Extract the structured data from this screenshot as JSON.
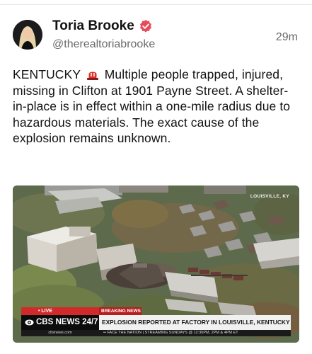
{
  "post": {
    "author_name": "Toria Brooke",
    "handle": "@therealtoriabrooke",
    "timestamp": "29m",
    "text_before_emoji": "KENTUCKY",
    "emoji": "siren-icon",
    "text_after_emoji": "Multiple people trapped, injured, missing in Clifton at 1901 Payne Street. A shelter-in-place is in effect within a one-mile radius due to hazardous materials. The exact cause of the explosion remains unknown."
  },
  "media": {
    "watermark": "LOUISVILLE, KY",
    "live_label": "• LIVE",
    "breaking_label": "BREAKING NEWS",
    "network": "CBS NEWS 24/7",
    "headline": "EXPLOSION REPORTED AT FACTORY IN LOUISVILLE, KENTUCKY",
    "site": "cbsnews.com",
    "ticker": "•• FACE THE NATION | STREAMING SUNDAYS @ 12:30PM, 2PM & 4PM ET"
  },
  "colors": {
    "verified_badge": "#e74c5a",
    "live_red": "#d22a2a"
  }
}
